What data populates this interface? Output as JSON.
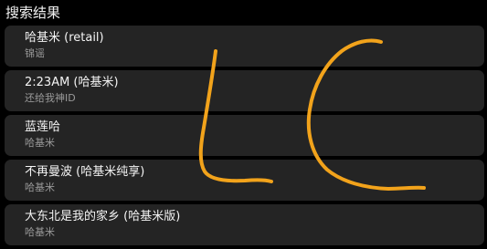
{
  "header": {
    "title": "搜索结果"
  },
  "results": [
    {
      "title": "哈基米 (retail)",
      "subtitle": "锦谣"
    },
    {
      "title": "2:23AM (哈基米)",
      "subtitle": "还给我神ID"
    },
    {
      "title": "蓝莲哈",
      "subtitle": "哈基米"
    },
    {
      "title": "不再曼波 (哈基米纯享)",
      "subtitle": "哈基米"
    },
    {
      "title": "大东北是我的家乡 (哈基米版)",
      "subtitle": "哈基米"
    }
  ],
  "annotation": {
    "letters": "LC",
    "stroke_color": "#f2a31b"
  },
  "colors": {
    "background": "#000000",
    "card": "#242424",
    "title_text": "#f4f4f4",
    "subtitle_text": "#9a9a9a"
  }
}
